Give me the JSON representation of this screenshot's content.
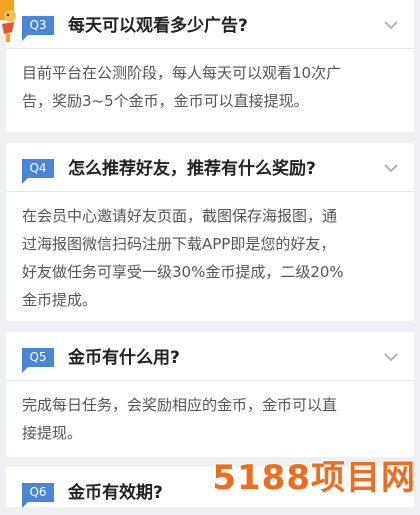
{
  "faq": [
    {
      "badge": "Q3",
      "question": "每天可以观看多少广告?",
      "answer_lines": [
        "目前平台在公测阶段，每人每天可以观看10次广",
        "告，奖励3~5个金币，金币可以直接提现。"
      ]
    },
    {
      "badge": "Q4",
      "question": "怎么推荐好友，推荐有什么奖励?",
      "answer_lines": [
        "在会员中心邀请好友页面，截图保存海报图，通",
        "过海报图微信扫码注册下载APP即是您的好友，",
        "好友做任务可享受一级30%金币提成，二级20%",
        "金币提成。"
      ]
    },
    {
      "badge": "Q5",
      "question": "金币有什么用?",
      "answer_lines": [
        "完成每日任务，会奖励相应的金币，金币可以直",
        "接提现。"
      ]
    },
    {
      "badge": "Q6",
      "question": "金币有效期?",
      "answer_lines": []
    }
  ],
  "watermark": "5188项目网",
  "colors": {
    "badge": "#4a86d8",
    "watermark": "#f26a1b",
    "background": "#eef0f3"
  }
}
